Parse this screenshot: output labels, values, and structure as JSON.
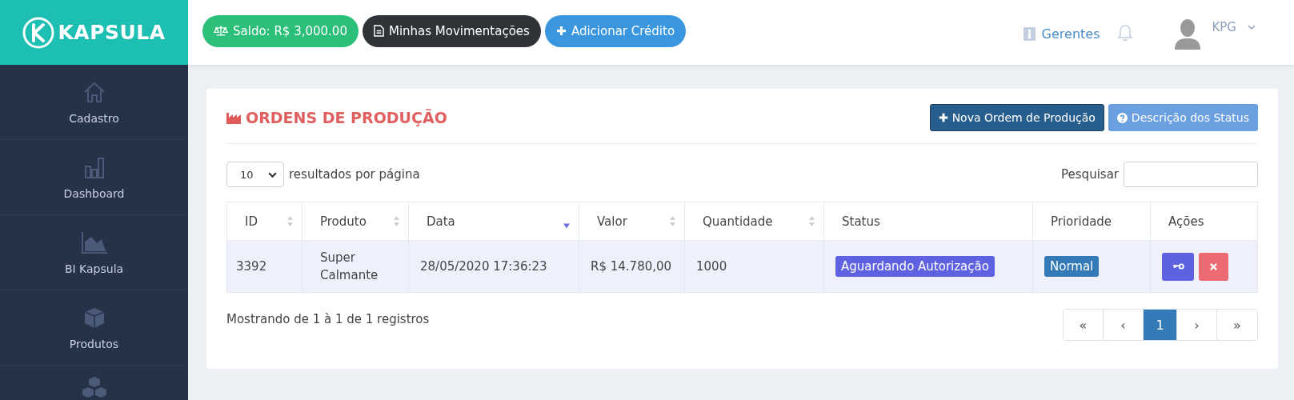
{
  "brand": {
    "name": "KAPSULA"
  },
  "topbar": {
    "buttons": [
      {
        "kind": "balance",
        "label": "Saldo: R$ 3,000.00"
      },
      {
        "kind": "statement",
        "label": "Minhas Movimentações"
      },
      {
        "kind": "credit",
        "label": "Adicionar Crédito"
      }
    ],
    "managers_link": "Gerentes",
    "user": "KPG"
  },
  "sidebar": {
    "items": [
      {
        "label": "Cadastro"
      },
      {
        "label": "Dashboard"
      },
      {
        "label": "BI Kapsula"
      },
      {
        "label": "Produtos"
      }
    ]
  },
  "panel": {
    "title": "ORDENS DE PRODUÇÃO",
    "actions": [
      {
        "kind": "new",
        "label": "Nova Ordem de Produção"
      },
      {
        "kind": "help",
        "label": "Descrição dos Status"
      }
    ],
    "page_size": "10",
    "page_size_label": "resultados por página",
    "search_label": "Pesquisar",
    "table": {
      "columns": [
        {
          "label": "ID",
          "sorted": false
        },
        {
          "label": "Produto",
          "sorted": false
        },
        {
          "label": "Data",
          "sorted": true
        },
        {
          "label": "Valor",
          "sorted": false
        },
        {
          "label": "Quantidade",
          "sorted": false
        },
        {
          "label": "Status"
        },
        {
          "label": "Prioridade"
        },
        {
          "label": "Ações"
        }
      ],
      "rows": [
        {
          "id": "3392",
          "product": "Super Calmante",
          "date": "28/05/2020 17:36:23",
          "value": "R$ 14.780,00",
          "quantity": "1000",
          "status": "Aguardando Autorização",
          "priority": "Normal"
        }
      ]
    },
    "summary": "Mostrando de 1 à 1 de 1 registros",
    "pagination": [
      {
        "label": "«",
        "selected": false
      },
      {
        "label": "‹",
        "selected": false
      },
      {
        "label": "1",
        "selected": true
      },
      {
        "label": "›",
        "selected": false
      },
      {
        "label": "»",
        "selected": false
      }
    ]
  }
}
